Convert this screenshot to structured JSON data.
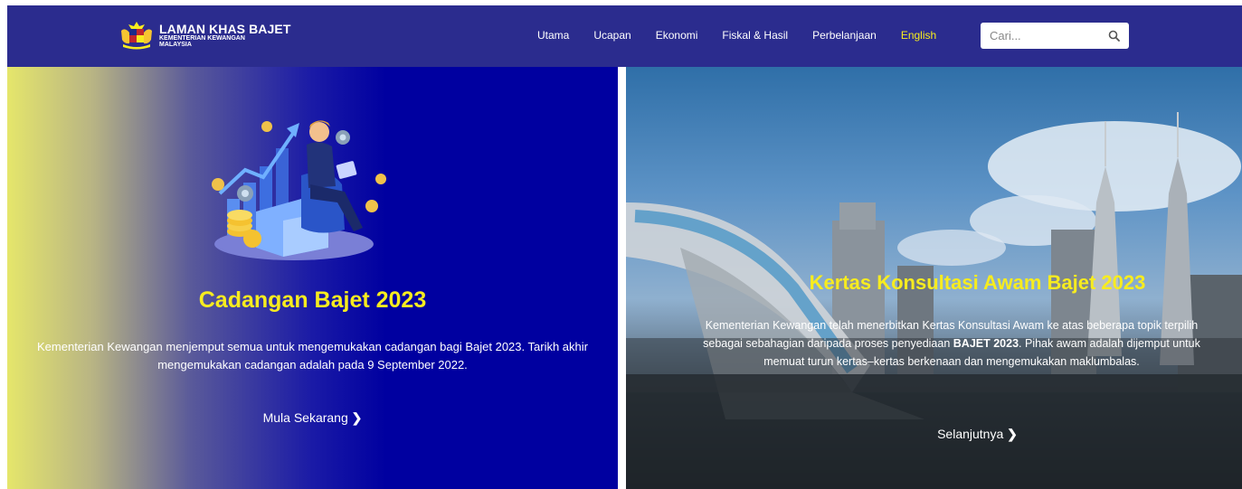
{
  "brand": {
    "title": "LAMAN KHAS BAJET",
    "sub1": "KEMENTERIAN KEWANGAN",
    "sub2": "MALAYSIA"
  },
  "nav": {
    "items": [
      {
        "label": "Utama"
      },
      {
        "label": "Ucapan"
      },
      {
        "label": "Ekonomi"
      },
      {
        "label": "Fiskal & Hasil"
      },
      {
        "label": "Perbelanjaan"
      },
      {
        "label": "English"
      }
    ],
    "active_color": "#f7ec1f"
  },
  "search": {
    "placeholder": "Cari..."
  },
  "left": {
    "title": "Cadangan Bajet 2023",
    "desc": "Kementerian Kewangan menjemput semua untuk mengemukakan cadangan bagi Bajet 2023. Tarikh akhir mengemukakan cadangan adalah pada 9 September 2022.",
    "cta": "Mula Sekarang"
  },
  "right": {
    "title": "Kertas Konsultasi Awam Bajet 2023",
    "desc_pre": "Kementerian Kewangan telah menerbitkan Kertas Konsultasi Awam ke atas beberapa topik terpilih sebagai sebahagian daripada proses penyediaan ",
    "desc_bold": "BAJET 2023",
    "desc_post": ". Pihak awam adalah dijemput untuk memuat turun kertas–kertas berkenaan dan mengemukakan maklumbalas.",
    "cta": "Selanjutnya"
  },
  "colors": {
    "header_bg": "#2b2c8e",
    "accent_yellow": "#f7ec1f",
    "panel_blue": "#0000a0"
  }
}
